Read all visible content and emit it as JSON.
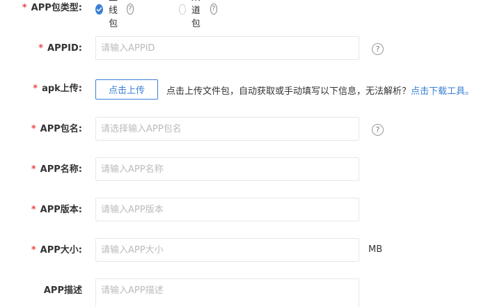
{
  "form": {
    "app_type": {
      "required": "*",
      "label": "APP包类型:",
      "options": [
        {
          "label": "主线包",
          "checked": true
        },
        {
          "label": "渠道包",
          "checked": false
        }
      ],
      "help_icon": "question-circle"
    },
    "appid": {
      "required": "*",
      "label": "APPID:",
      "value": "",
      "placeholder": "请输入APPID",
      "help_icon": "question-circle"
    },
    "apk_upload": {
      "required": "*",
      "label": "apk上传:",
      "button": "点击上传",
      "hint": "点击上传文件包，自动获取或手动填写以下信息，无法解析？",
      "link": "点击下载工具。"
    },
    "package_name": {
      "required": "*",
      "label": "APP包名:",
      "value": "",
      "placeholder": "请选择输入APP包名",
      "help_icon": "question-circle"
    },
    "app_name": {
      "required": "*",
      "label": "APP名称:",
      "value": "",
      "placeholder": "请输入APP名称"
    },
    "app_version": {
      "required": "*",
      "label": "APP版本:",
      "value": "",
      "placeholder": "请输入APP版本"
    },
    "app_size": {
      "required": "*",
      "label": "APP大小:",
      "value": "",
      "placeholder": "请输入APP大小",
      "unit": "MB"
    },
    "app_desc": {
      "label": "APP描述",
      "value": "",
      "placeholder": "请输入APP描述"
    }
  },
  "colors": {
    "accent": "#3a7fd5",
    "required": "#e84a4a",
    "border": "#e6e6e6",
    "placeholder": "#bbbbbb"
  }
}
